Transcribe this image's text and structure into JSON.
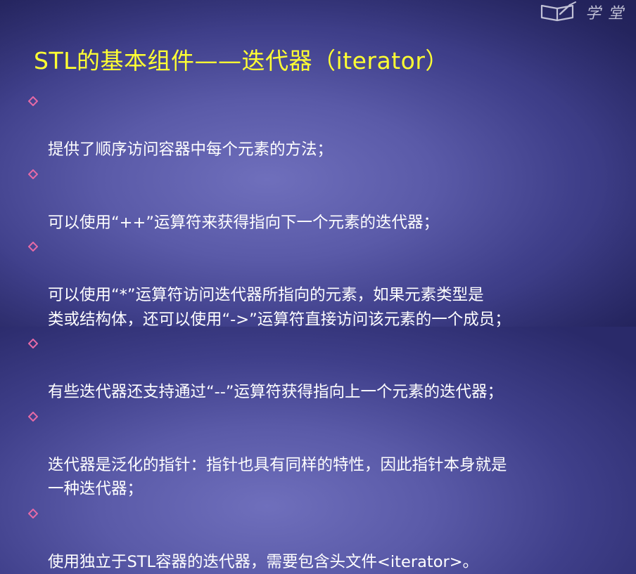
{
  "watermark": {
    "icon": "book-icon",
    "text": "学堂"
  },
  "slide": {
    "title": "STL的基本组件——迭代器（iterator）",
    "bullet_icon": "diamond-bullet-icon",
    "bullet_color": "#e66aa6",
    "title_color": "#ffff33",
    "bullets": [
      "提供了顺序访问容器中每个元素的方法；",
      "可以使用“++”运算符来获得指向下一个元素的迭代器；",
      "可以使用“*”运算符访问迭代器所指向的元素，如果元素类型是\n类或结构体，还可以使用“->”运算符直接访问该元素的一个成员；",
      "有些迭代器还支持通过“--”运算符获得指向上一个元素的迭代器；",
      "迭代器是泛化的指针：指针也具有同样的特性，因此指针本身就是\n一种迭代器；",
      "使用独立于STL容器的迭代器，需要包含头文件<iterator>。"
    ]
  }
}
